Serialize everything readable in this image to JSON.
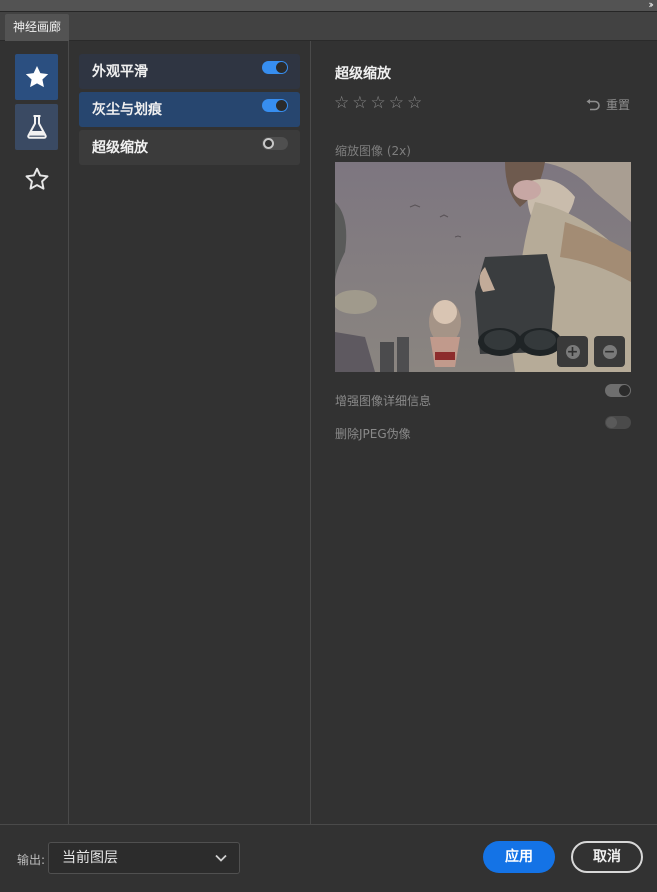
{
  "window": {
    "tab_title": "神经画廊",
    "collapse_glyph": "››"
  },
  "categories": [
    {
      "icon": "star-filled-icon",
      "active": true
    },
    {
      "icon": "flask-icon",
      "active": false
    },
    {
      "icon": "star-outline-icon",
      "active": false
    }
  ],
  "filters": [
    {
      "label": "外观平滑",
      "enabled": true
    },
    {
      "label": "灰尘与划痕",
      "enabled": true
    },
    {
      "label": "超级缩放",
      "enabled": false
    }
  ],
  "detail": {
    "title": "超级缩放",
    "rating": 0,
    "rating_max": 5,
    "reset_label": "重置",
    "preview_label": "缩放图像 (2x)",
    "zoom_in_glyph": "+",
    "zoom_out_glyph": "−",
    "options": [
      {
        "label": "增强图像详细信息",
        "enabled": true
      },
      {
        "label": "删除JPEG伪像",
        "enabled": false
      }
    ]
  },
  "footer": {
    "output_label": "输出:",
    "output_value": "当前图层",
    "apply_label": "应用",
    "cancel_label": "取消"
  },
  "colors": {
    "panel_bg": "#323232",
    "accent_blue": "#1473e6",
    "selected_item": "#27466f",
    "toggle_on": "#378ef0"
  }
}
